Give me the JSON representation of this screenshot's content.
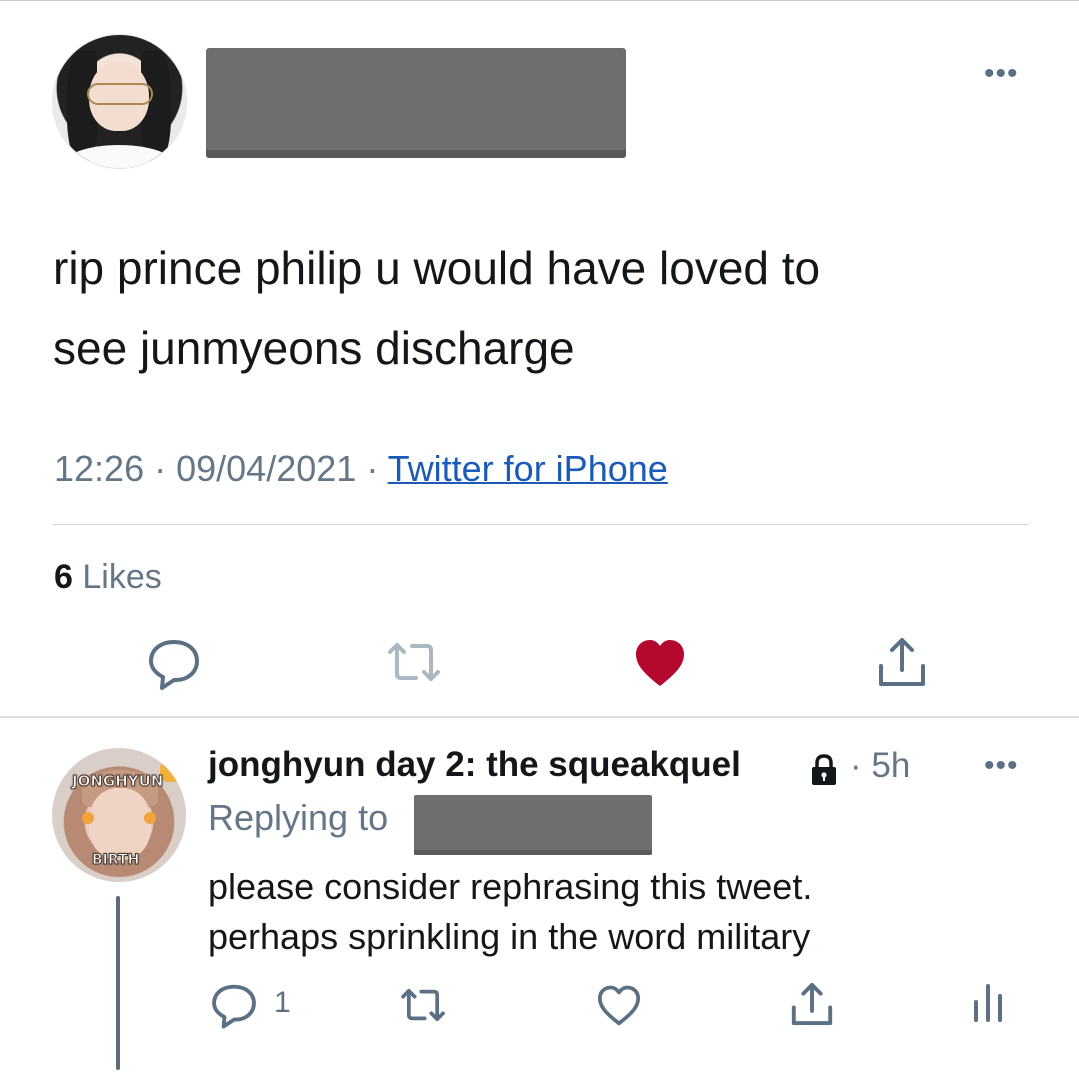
{
  "main_tweet": {
    "more_label": "•••",
    "text_line1": "rip prince philip u would have loved to",
    "text_line2": "see junmyeons discharge",
    "time": "12:26",
    "date": "09/04/2021",
    "source": "Twitter for iPhone",
    "likes_count": "6",
    "likes_label": "Likes",
    "liked": true,
    "like_color": "#b5082f"
  },
  "reply": {
    "avatar_label_top": "JONGHYUN",
    "avatar_label_bottom": "BIRTH",
    "display_name": "jonghyun day 2: the squeakquel",
    "time": "5h",
    "more_label": "•••",
    "replying_to_label": "Replying to",
    "text_line1": "please consider rephrasing this tweet.",
    "text_line2": "perhaps sprinkling in the word military",
    "reply_count": "1",
    "protected": true
  },
  "colors": {
    "text": "#14171a",
    "secondary": "#657786",
    "link": "#1b5bb7",
    "icon": "#5b7083",
    "divider": "#d6d9dc"
  }
}
